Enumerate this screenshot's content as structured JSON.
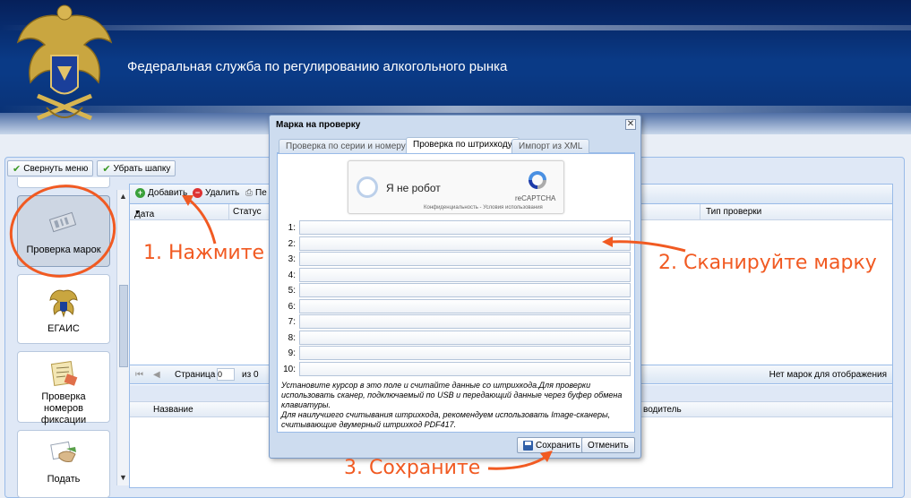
{
  "banner": {
    "title": "Федеральная служба по регулированию алкогольного рынка"
  },
  "toolbar": {
    "collapse_menu": "Свернуть меню",
    "hide_header": "Убрать шапку"
  },
  "nav": {
    "items": [
      {
        "label": "Проверка марок",
        "icon": "stamp-check-icon",
        "active": true
      },
      {
        "label": "ЕГАИС",
        "icon": "emblem-icon"
      },
      {
        "label": "Проверка номеров фиксации",
        "icon": "document-check-icon"
      },
      {
        "label": "Подать",
        "icon": "handshake-icon"
      }
    ]
  },
  "grid": {
    "add": "Добавить",
    "delete": "Удалить",
    "print_partial": "Пе",
    "columns": {
      "date": "Дата",
      "status": "Статус",
      "check_type": "Тип проверки"
    },
    "pager": {
      "page": "Страница",
      "page_value": "0",
      "of": "из 0",
      "empty": "Нет марок для отображения"
    },
    "lower_columns": {
      "name": "Название",
      "producer_partial": "водитель"
    }
  },
  "modal": {
    "title": "Марка на проверку",
    "tabs": [
      "Проверка по серии и номеру",
      "Проверка по штрихкоду",
      "Импорт из XML"
    ],
    "active_tab": 1,
    "captcha": {
      "label": "Я не робот",
      "brand": "reCAPTCHA",
      "terms": "Конфиденциальность - Условия использования"
    },
    "rows": [
      "1:",
      "2:",
      "3:",
      "4:",
      "5:",
      "6:",
      "7:",
      "8:",
      "9:",
      "10:"
    ],
    "hint_1": "Установите курсор в это поле и считайте данные со штрихкода.Для проверки использовать сканер, подключаемый по USB и передающий данные через буфер обмена клавиатуры.",
    "hint_2": "Для наилучшего считывания штрихкода, рекомендуем использовать Image-сканеры, считывающие двумерный штрихкод PDF417.",
    "save": "Сохранить",
    "cancel": "Отменить"
  },
  "annotations": {
    "step1": "1. Нажмите",
    "step2": "2. Сканируйте марку",
    "step3": "3. Сохраните",
    "color": "#f15a22"
  }
}
